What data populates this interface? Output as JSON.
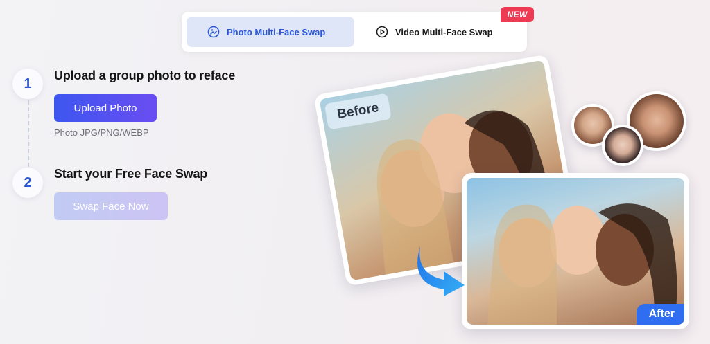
{
  "tabs": [
    {
      "label": "Photo Multi-Face Swap",
      "icon": "image-icon",
      "active": true
    },
    {
      "label": "Video Multi-Face Swap",
      "icon": "play-circle-icon",
      "active": false
    }
  ],
  "new_badge": "NEW",
  "steps": [
    {
      "number": "1",
      "title": "Upload a group photo to reface",
      "button": "Upload Photo",
      "hint": "Photo JPG/PNG/WEBP"
    },
    {
      "number": "2",
      "title": "Start your Free Face Swap",
      "button": "Swap Face Now"
    }
  ],
  "illustration": {
    "before_label": "Before",
    "after_label": "After"
  },
  "colors": {
    "accent": "#2e57d4",
    "upload_gradient_start": "#3d56ef",
    "upload_gradient_end": "#6a4df2",
    "new_badge": "#ec3b52",
    "after_tag": "#2f6ef0",
    "arrow": "#2a8ef0"
  }
}
